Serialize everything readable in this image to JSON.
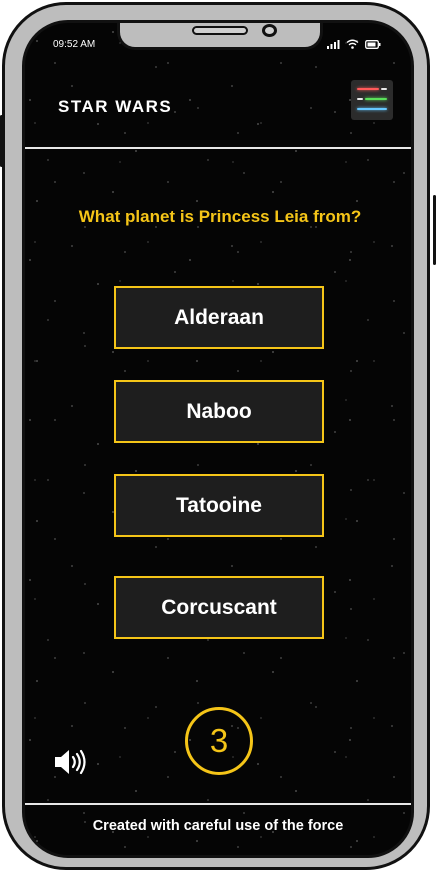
{
  "status_bar": {
    "time": "09:52 AM",
    "icons": [
      "signal-icon",
      "wifi-icon",
      "battery-icon"
    ]
  },
  "header": {
    "logo_text": "STAR WARS",
    "menu_icon": "hamburger-lightsaber-icon",
    "menu_bar_colors": [
      "#ff5a5a",
      "#e8e8e8",
      "#5ae05a",
      "#e8e8e8",
      "#66c8ff"
    ]
  },
  "quiz": {
    "question": "What planet is Princess Leia from?",
    "answers": [
      "Alderaan",
      "Naboo",
      "Tatooine",
      "Corcuscant"
    ],
    "timer": "3"
  },
  "controls": {
    "sound_icon": "speaker-volume-icon"
  },
  "footer": {
    "text": "Created with careful use of the force"
  },
  "colors": {
    "accent": "#f5c518",
    "background": "#050505",
    "answer_bg": "#1e1e1e",
    "text": "#ffffff"
  }
}
